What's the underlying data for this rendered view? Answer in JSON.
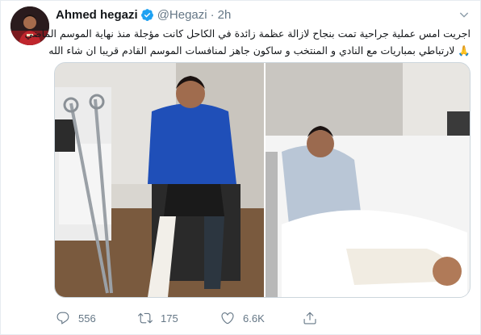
{
  "tweet": {
    "author_name": "Ahmed hegazi",
    "handle": "@Hegazi",
    "separator": "·",
    "time": "2h",
    "text_line1": "اجريت امس عملية جراحية تمت بنجاح لازالة عظمة زائدة في الكاحل كانت مؤجلة منذ نهاية الموسم الماضي",
    "text_line2": "لارتباطي بمباريات مع النادي و المنتخب و ساكون جاهز لمنافسات الموسم القادم قريبا ان شاء الله",
    "text_emoji": "🙏",
    "replies": "556",
    "retweets": "175",
    "likes": "6.6K"
  },
  "icons": {
    "verified": "verified-badge-icon",
    "caret": "chevron-down-icon",
    "reply": "reply-icon",
    "retweet": "retweet-icon",
    "like": "heart-icon",
    "share": "share-icon"
  },
  "colors": {
    "text": "#14171a",
    "secondary": "#657786",
    "verified": "#1da1f2",
    "border": "#e6ecf0"
  }
}
